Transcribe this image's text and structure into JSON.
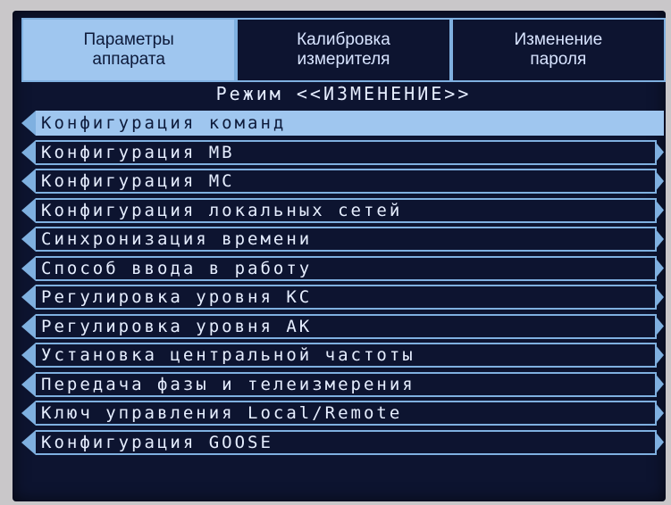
{
  "tabs": [
    {
      "label": "Параметры\nаппарата",
      "active": true
    },
    {
      "label": "Калибровка\nизмерителя",
      "active": false
    },
    {
      "label": "Изменение\nпароля",
      "active": false
    }
  ],
  "mode_title": "Режим <<ИЗМЕНЕНИЕ>>",
  "menu": {
    "selected_index": 0,
    "items": [
      "Конфигурация команд",
      "Конфигурация МВ",
      "Конфигурация МС",
      "Конфигурация локальных сетей",
      "Синхронизация времени",
      "Способ ввода в работу",
      "Регулировка уровня КС",
      "Регулировка уровня АК",
      "Установка центральной частоты",
      "Передача фазы и телеизмерения",
      "Ключ управления Local/Remote",
      "Конфигурация GOOSE"
    ]
  },
  "colors": {
    "screen_bg": "#0d1430",
    "accent": "#7fb0e0",
    "highlight": "#9fc6ef",
    "text": "#e6eeff"
  }
}
